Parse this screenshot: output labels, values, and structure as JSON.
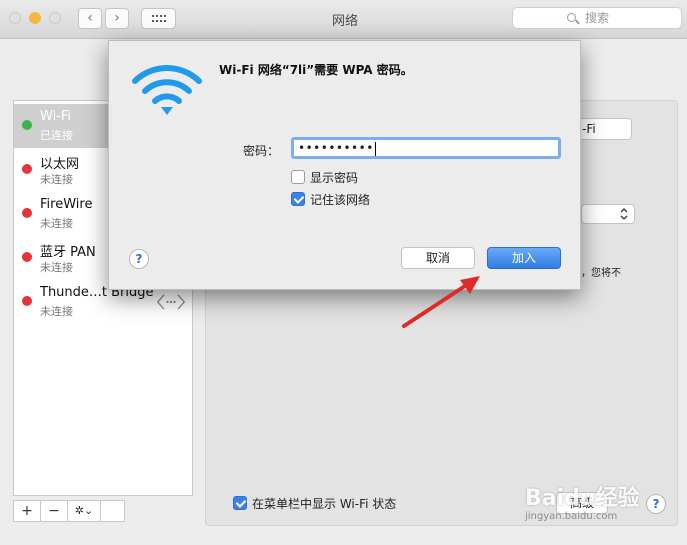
{
  "window": {
    "title": "网络",
    "search_placeholder": "搜索",
    "nav_back": "‹",
    "nav_forward": "›"
  },
  "sidebar": {
    "items": [
      {
        "name": "Wi-Fi",
        "status": "已连接",
        "color": "#3ab54a",
        "selected": true
      },
      {
        "name": "以太网",
        "status": "未连接",
        "color": "#e3363c"
      },
      {
        "name": "FireWire",
        "status": "未连接",
        "color": "#e3363c"
      },
      {
        "name": "蓝牙 PAN",
        "status": "未连接",
        "color": "#e3363c"
      },
      {
        "name": "Thunde…t Bridge",
        "status": "未连接",
        "color": "#e3363c"
      }
    ],
    "add_label": "+",
    "remove_label": "−",
    "gear_label": "✲⌄"
  },
  "panel": {
    "wifi_button_partial": "-Fi",
    "side_note_partial": "，您将不",
    "menubar_checkbox_label": "在菜单栏中显示 Wi-Fi 状态",
    "menubar_checked": true,
    "advanced_partial": "高级"
  },
  "dialog": {
    "title": "Wi-Fi 网络“7li”需要 WPA 密码。",
    "password_label": "密码：",
    "password_value": "••••••••••",
    "show_password_label": "显示密码",
    "show_password_checked": false,
    "remember_label": "记住该网络",
    "remember_checked": true,
    "cancel_label": "取消",
    "join_label": "加入",
    "help_label": "?"
  },
  "watermark": {
    "brand": "Baidu经验",
    "url": "jingyan.baidu.com"
  },
  "colors": {
    "accent": "#3b82e6",
    "arrow": "#e02a27",
    "wifi": "#1f9bea"
  }
}
